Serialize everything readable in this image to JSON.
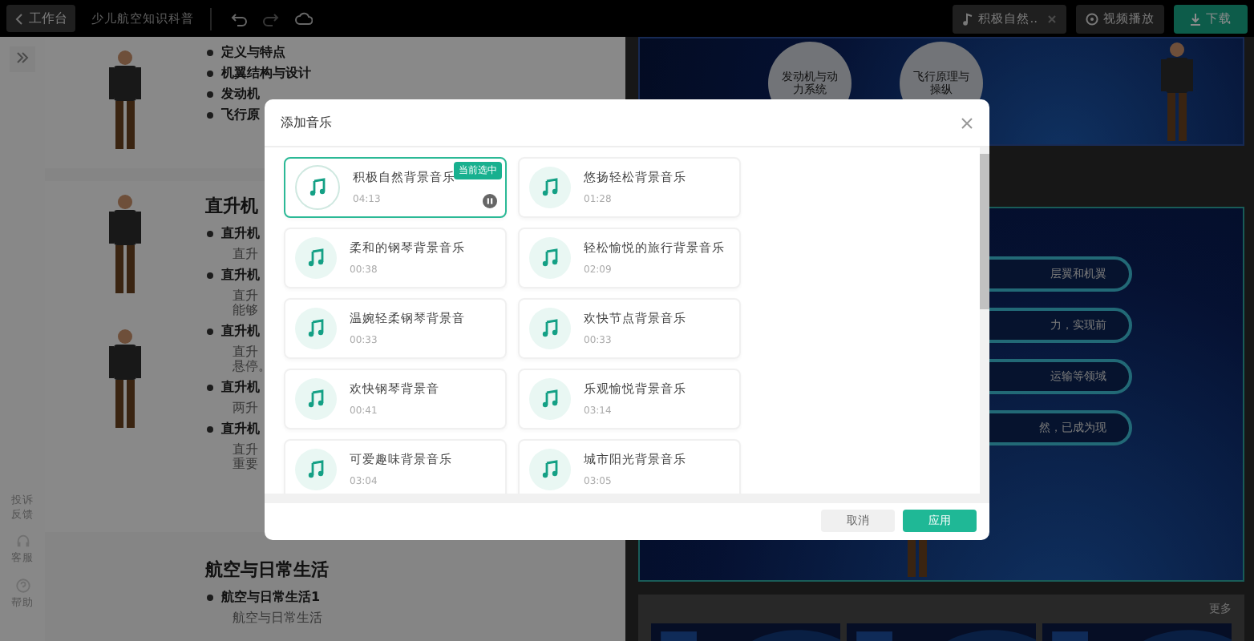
{
  "topbar": {
    "back": "工作台",
    "project_title": "少儿航空知识科普",
    "music_chip": "积极自然..",
    "video_button": "视频播放",
    "download_button": "下载"
  },
  "sidebar": {
    "items": [
      {
        "kind": "feedback",
        "label": "投诉反馈"
      },
      {
        "kind": "support",
        "label": "客服"
      },
      {
        "kind": "help",
        "label": "帮助"
      }
    ]
  },
  "editor": {
    "sections": [
      {
        "people": [
          {
            "kind": "figure"
          }
        ],
        "items": [
          {
            "kind": "bullet",
            "text": "定义与特点"
          },
          {
            "kind": "bullet",
            "text": "机翼结构与设计"
          },
          {
            "kind": "bullet",
            "text": "发动机"
          },
          {
            "kind": "bullet",
            "text": "飞行原"
          }
        ]
      },
      {
        "heading": "直升机",
        "people": [
          {
            "kind": "figure"
          },
          {
            "kind": "figure"
          }
        ],
        "items": [
          {
            "kind": "bullet",
            "text": "直升机"
          },
          {
            "kind": "sub",
            "text": "直升"
          },
          {
            "kind": "bullet",
            "text": "直升机"
          },
          {
            "kind": "sub",
            "text": "直升"
          },
          {
            "kind": "line",
            "text": "能够"
          },
          {
            "kind": "bullet",
            "text": "直升机"
          },
          {
            "kind": "sub",
            "text": "直升"
          },
          {
            "kind": "line",
            "text": "悬停。"
          },
          {
            "kind": "bullet",
            "text": "直升机"
          },
          {
            "kind": "sub",
            "text": "两升"
          },
          {
            "kind": "bullet",
            "text": "直升机"
          },
          {
            "kind": "sub",
            "text": "直升"
          },
          {
            "kind": "line",
            "text": "重要"
          }
        ]
      },
      {
        "heading": "航空与日常生活",
        "items": [
          {
            "kind": "bullet",
            "text": "航空与日常生活1"
          },
          {
            "kind": "sub",
            "text": "航空与日常生活"
          }
        ]
      }
    ]
  },
  "slides": [
    {
      "kind": "circles",
      "labels": [
        "发动机与动力系统",
        "飞行原理与操纵"
      ]
    },
    {
      "kind": "pills",
      "labels": [
        "层翼和机翼",
        "力，实现前",
        "运输等领域",
        "然，已成为现"
      ]
    }
  ],
  "recommend": {
    "more": "更多"
  },
  "dialog": {
    "title": "添加音乐",
    "badge": "当前选中",
    "tracks": [
      {
        "name": "积极自然背景音乐",
        "duration": "04:13",
        "selected": true,
        "playing": true
      },
      {
        "name": "悠扬轻松背景音乐",
        "duration": "01:28",
        "selected": false,
        "playing": false
      },
      {
        "name": "柔和的钢琴背景音乐",
        "duration": "00:38",
        "selected": false,
        "playing": false
      },
      {
        "name": "轻松愉悦的旅行背景音乐",
        "duration": "02:09",
        "selected": false,
        "playing": false
      },
      {
        "name": "温婉轻柔钢琴背景音",
        "duration": "00:33",
        "selected": false,
        "playing": false
      },
      {
        "name": "欢快节点背景音乐",
        "duration": "00:33",
        "selected": false,
        "playing": false
      },
      {
        "name": "欢快钢琴背景音",
        "duration": "00:41",
        "selected": false,
        "playing": false
      },
      {
        "name": "乐观愉悦背景音乐",
        "duration": "03:14",
        "selected": false,
        "playing": false
      },
      {
        "name": "可爱趣味背景音乐",
        "duration": "03:04",
        "selected": false,
        "playing": false
      },
      {
        "name": "城市阳光背景音乐",
        "duration": "03:05",
        "selected": false,
        "playing": false
      }
    ],
    "cancel": "取消",
    "apply": "应用"
  }
}
